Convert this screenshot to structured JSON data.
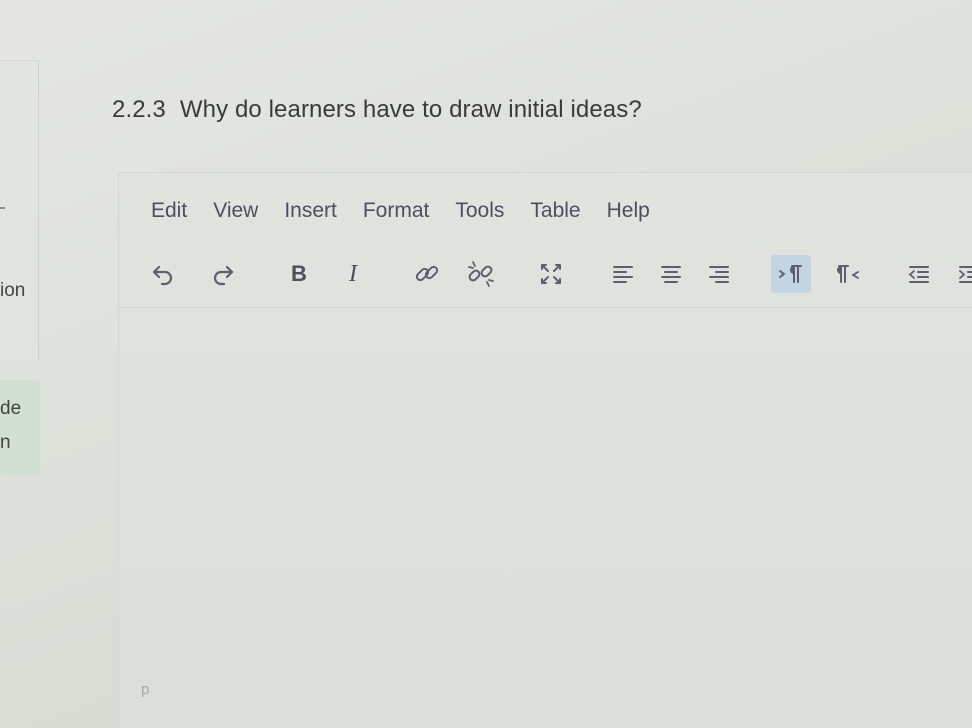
{
  "sidebar": {
    "partial_items": [
      "ion",
      "de",
      "n"
    ]
  },
  "question": {
    "number": "2.2.3",
    "text": "Why do learners have to draw initial ideas?"
  },
  "editor": {
    "menu": [
      "Edit",
      "View",
      "Insert",
      "Format",
      "Tools",
      "Table",
      "Help"
    ],
    "toolbar": {
      "bold_label": "B",
      "italic_label": "I"
    },
    "status_path": "p"
  },
  "colors": {
    "background": "#dfe1dc",
    "toolbar_icon": "#5a6070",
    "active_button": "#c3d5e0",
    "sidebar_active": "#d2e0d4"
  },
  "icons": [
    "undo-icon",
    "redo-icon",
    "bold-icon",
    "italic-icon",
    "link-icon",
    "unlink-icon",
    "fullscreen-icon",
    "align-left-icon",
    "align-center-icon",
    "align-right-icon",
    "ltr-icon",
    "rtl-icon",
    "outdent-icon",
    "indent-icon"
  ]
}
